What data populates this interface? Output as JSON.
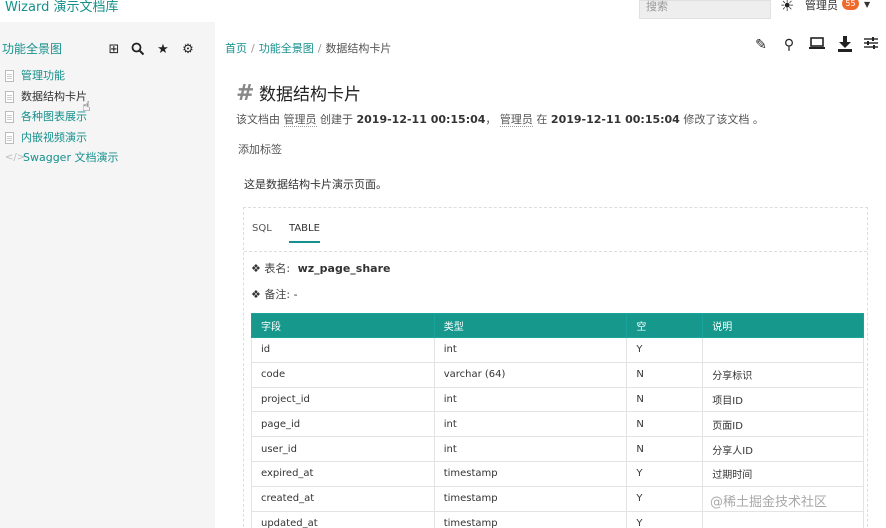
{
  "header": {
    "brand": "Wizard 演示文档库",
    "search_placeholder": "搜索",
    "user_name": "管理员",
    "notification_count": "55"
  },
  "sidebar": {
    "title": "功能全景图",
    "items": [
      {
        "label": "管理功能",
        "icon": "doc-icon"
      },
      {
        "label": "数据结构卡片",
        "icon": "doc-icon",
        "active": true
      },
      {
        "label": "各种图表展示",
        "icon": "doc-icon"
      },
      {
        "label": "内嵌视频演示",
        "icon": "doc-icon"
      },
      {
        "label": "Swagger 文档演示",
        "icon": "code-icon"
      }
    ]
  },
  "breadcrumb": {
    "home": "首页",
    "parent": "功能全景图",
    "current": "数据结构卡片"
  },
  "document": {
    "title": "数据结构卡片",
    "meta": {
      "prefix": "该文档由",
      "creator": "管理员",
      "created_label": "创建于",
      "created_at": "2019-12-11 00:15:04",
      "comma": "，",
      "modifier": "管理员",
      "modified_label": "在",
      "modified_at": "2019-12-11 00:15:04",
      "suffix": "修改了该文档 。"
    },
    "add_tag": "添加标签",
    "intro": "这是数据结构卡片演示页面。"
  },
  "card": {
    "tabs": [
      "SQL",
      "TABLE"
    ],
    "active_tab": "TABLE",
    "table_name_label": "表名:",
    "table_name": "wz_page_share",
    "comment_label": "备注:",
    "comment": "-",
    "columns": [
      "字段",
      "类型",
      "空",
      "说明"
    ],
    "rows": [
      [
        "id",
        "int",
        "Y",
        ""
      ],
      [
        "code",
        "varchar (64)",
        "N",
        "分享标识"
      ],
      [
        "project_id",
        "int",
        "N",
        "项目ID"
      ],
      [
        "page_id",
        "int",
        "N",
        "页面ID"
      ],
      [
        "user_id",
        "int",
        "N",
        "分享人ID"
      ],
      [
        "expired_at",
        "timestamp",
        "Y",
        "过期时间"
      ],
      [
        "created_at",
        "timestamp",
        "Y",
        ""
      ],
      [
        "updated_at",
        "timestamp",
        "Y",
        ""
      ]
    ]
  },
  "watermark": "@稀土掘金技术社区",
  "colors": {
    "accent": "#16908c",
    "table_header": "#16988d",
    "badge": "#f0692b",
    "sidebar_bg": "#f5f5f5"
  }
}
